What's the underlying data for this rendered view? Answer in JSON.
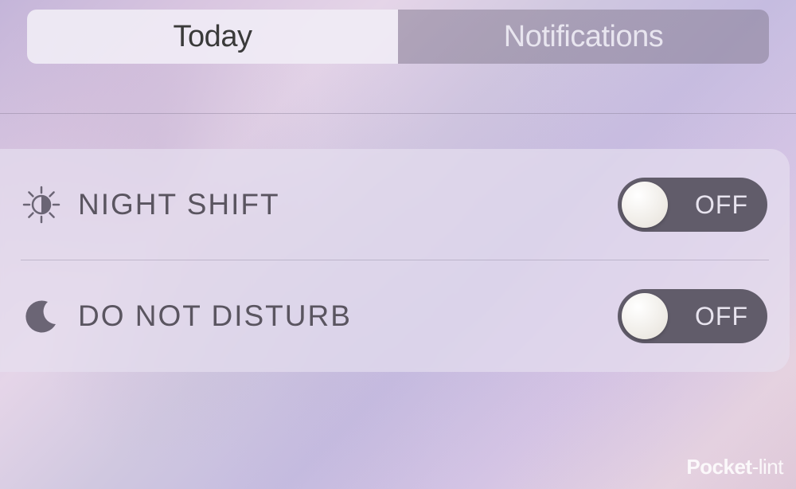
{
  "tabs": {
    "today": "Today",
    "notifications": "Notifications"
  },
  "widgets": {
    "nightShift": {
      "label": "NIGHT SHIFT",
      "state": "OFF"
    },
    "doNotDisturb": {
      "label": "DO NOT DISTURB",
      "state": "OFF"
    }
  },
  "watermark": {
    "prefix": "Pocket",
    "suffix": "-lint"
  }
}
